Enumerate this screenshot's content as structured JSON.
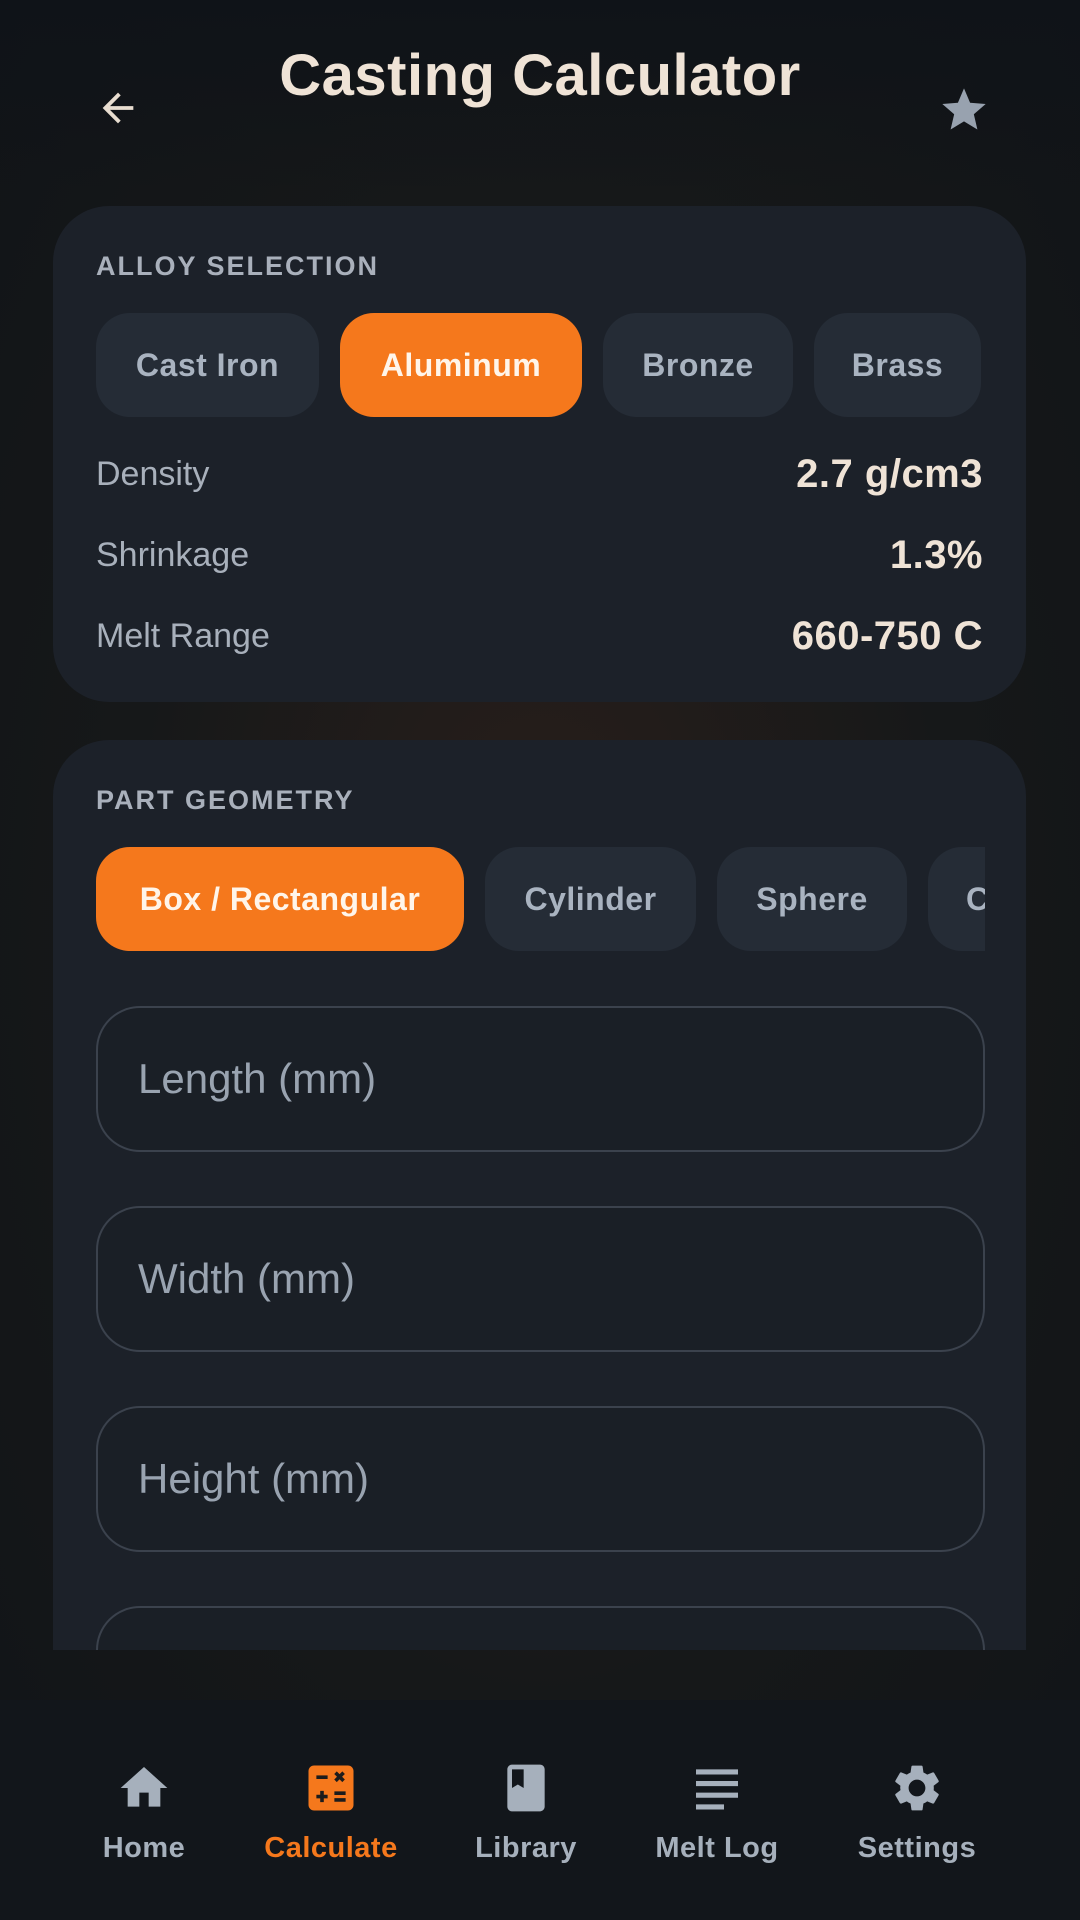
{
  "header": {
    "title": "Casting Calculator",
    "back_icon": "arrow-left-icon",
    "favorite_icon": "star-icon"
  },
  "alloy": {
    "section_label": "ALLOY SELECTION",
    "options": [
      "Cast Iron",
      "Aluminum",
      "Bronze",
      "Brass"
    ],
    "selected": "Aluminum",
    "properties": [
      {
        "name": "Density",
        "value": "2.7 g/cm3"
      },
      {
        "name": "Shrinkage",
        "value": "1.3%"
      },
      {
        "name": "Melt Range",
        "value": "660-750 C"
      }
    ]
  },
  "geometry": {
    "section_label": "PART GEOMETRY",
    "options": [
      "Box / Rectangular",
      "Cylinder",
      "Sphere",
      "C"
    ],
    "selected": "Box / Rectangular",
    "fields": [
      {
        "placeholder": "Length (mm)",
        "value": ""
      },
      {
        "placeholder": "Width (mm)",
        "value": ""
      },
      {
        "placeholder": "Height (mm)",
        "value": ""
      }
    ]
  },
  "nav": {
    "items": [
      {
        "label": "Home",
        "icon": "home-icon"
      },
      {
        "label": "Calculate",
        "icon": "calculator-icon",
        "active": true
      },
      {
        "label": "Library",
        "icon": "book-icon"
      },
      {
        "label": "Melt Log",
        "icon": "list-icon"
      },
      {
        "label": "Settings",
        "icon": "gear-icon"
      }
    ]
  },
  "colors": {
    "accent": "#f5781c",
    "card": "#1c2129",
    "chip": "#252c36",
    "background": "#111417"
  }
}
